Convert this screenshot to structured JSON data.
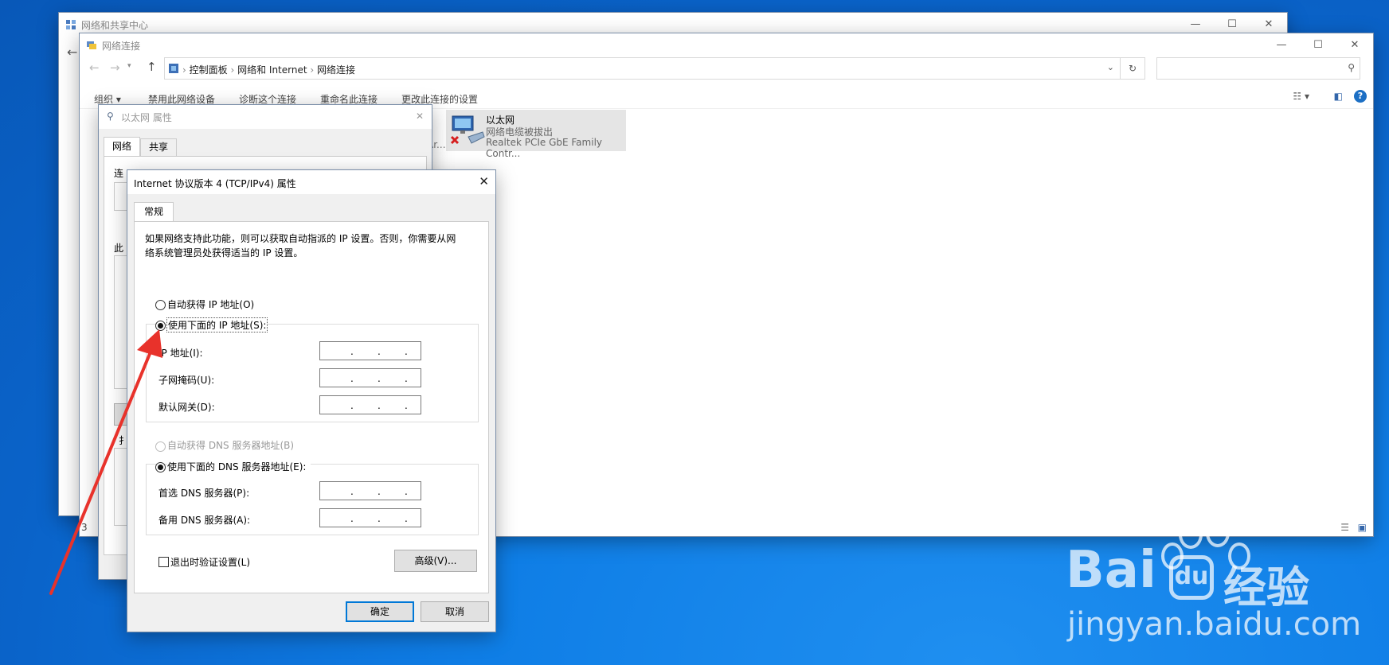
{
  "nsc_window": {
    "title": "网络和共享中心"
  },
  "nc_window": {
    "title": "网络连接",
    "breadcrumb": [
      "控制面板",
      "网络和 Internet",
      "网络连接"
    ],
    "search_placeholder": "",
    "commands": [
      "组织 ▾",
      "禁用此网络设备",
      "诊断这个连接",
      "重命名此连接",
      "更改此连接的设置"
    ],
    "partial_item_text": "ersonal Ar...",
    "adapter": {
      "name": "以太网",
      "status": "网络电缆被拔出",
      "device": "Realtek PCIe GbE Family Contr..."
    },
    "status_count": "3"
  },
  "eth_props": {
    "title": "以太网 属性",
    "tabs": [
      "网络",
      "共享"
    ],
    "partial_labels": [
      "连",
      "此",
      "扌"
    ]
  },
  "ipv4": {
    "title": "Internet 协议版本 4 (TCP/IPv4) 属性",
    "tab": "常规",
    "description": "如果网络支持此功能，则可以获取自动指派的 IP 设置。否则，你需要从网络系统管理员处获得适当的 IP 设置。",
    "auto_ip": "自动获得 IP 地址(O)",
    "manual_ip": "使用下面的 IP 地址(S):",
    "ip_label": "IP 地址(I):",
    "subnet_label": "子网掩码(U):",
    "gateway_label": "默认网关(D):",
    "auto_dns": "自动获得 DNS 服务器地址(B)",
    "manual_dns": "使用下面的 DNS 服务器地址(E):",
    "dns1_label": "首选 DNS 服务器(P):",
    "dns2_label": "备用 DNS 服务器(A):",
    "validate": "退出时验证设置(L)",
    "advanced": "高级(V)...",
    "ok": "确定",
    "cancel": "取消"
  },
  "watermark": {
    "brand": "Bai",
    "brand_cn": "经验",
    "url": "jingyan.baidu.com"
  },
  "colors": {
    "accent": "#0078d7",
    "annotation_arrow": "#e8322b",
    "selected_item": "#cce4f7"
  }
}
